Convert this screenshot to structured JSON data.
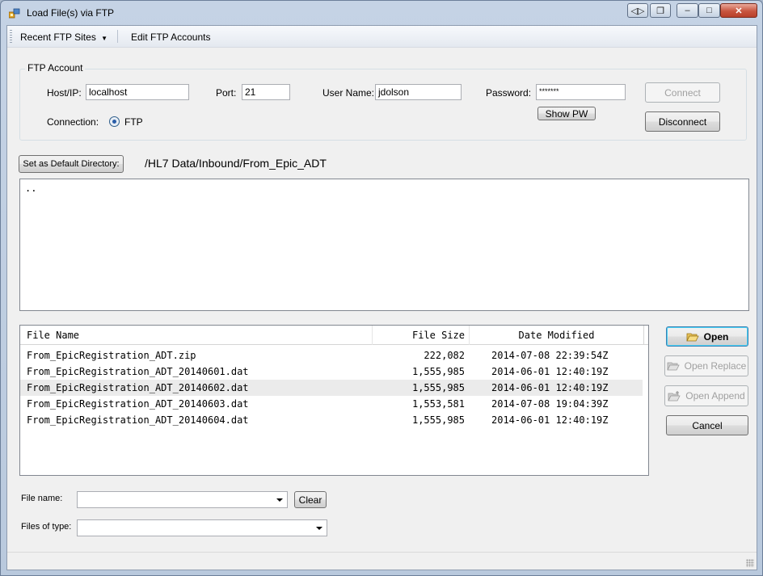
{
  "window": {
    "title": "Load File(s) via FTP"
  },
  "menu": {
    "recent_sites": "Recent FTP Sites",
    "edit_accounts": "Edit FTP Accounts"
  },
  "account": {
    "legend": "FTP Account",
    "host_label": "Host/IP:",
    "host_value": "localhost",
    "port_label": "Port:",
    "port_value": "21",
    "user_label": "User Name:",
    "user_value": "jdolson",
    "password_label": "Password:",
    "password_value": "*******",
    "connection_label": "Connection:",
    "connection_option": "FTP",
    "connect_button": "Connect",
    "disconnect_button": "Disconnect",
    "show_pw_button": "Show PW"
  },
  "directory": {
    "set_default_button": "Set as Default Directory:",
    "current_path": "/HL7 Data/Inbound/From_Epic_ADT",
    "items": [
      ".."
    ]
  },
  "files": {
    "columns": {
      "name": "File Name",
      "size": "File Size",
      "modified": "Date Modified"
    },
    "rows": [
      {
        "name": "From_EpicRegistration_ADT.zip",
        "size": "222,082",
        "modified": "2014-07-08 22:39:54Z"
      },
      {
        "name": "From_EpicRegistration_ADT_20140601.dat",
        "size": "1,555,985",
        "modified": "2014-06-01 12:40:19Z"
      },
      {
        "name": "From_EpicRegistration_ADT_20140602.dat",
        "size": "1,555,985",
        "modified": "2014-06-01 12:40:19Z"
      },
      {
        "name": "From_EpicRegistration_ADT_20140603.dat",
        "size": "1,553,581",
        "modified": "2014-07-08 19:04:39Z"
      },
      {
        "name": "From_EpicRegistration_ADT_20140604.dat",
        "size": "1,555,985",
        "modified": "2014-06-01 12:40:19Z"
      }
    ]
  },
  "actions": {
    "open": "Open",
    "open_replace": "Open Replace",
    "open_append": "Open Append",
    "cancel": "Cancel"
  },
  "bottom": {
    "file_name_label": "File name:",
    "file_name_value": "",
    "clear_button": "Clear",
    "file_type_label": "Files of type:",
    "file_type_value": ""
  },
  "icons": {
    "app": "ftp-app-icon",
    "folder_open": "folder-open-icon",
    "open_replace": "folder-replace-icon",
    "open_append": "folder-add-icon"
  },
  "colors": {
    "selection_row": "#ebebeb",
    "default_button_border": "#3c7fb1",
    "title_bar": "#c5d3e5"
  }
}
